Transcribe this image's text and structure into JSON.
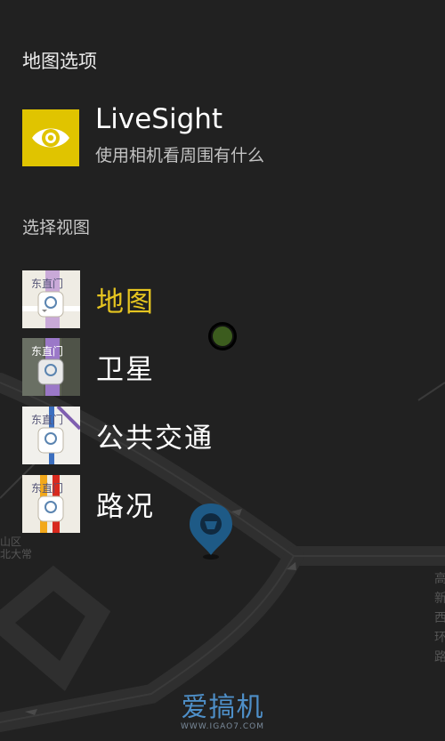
{
  "header": {
    "title": "地图选项"
  },
  "livesight": {
    "title": "LiveSight",
    "description": "使用相机看周围有什么",
    "icon": "eye-icon",
    "tile_color": "#e0c400"
  },
  "views": {
    "section_title": "选择视图",
    "items": [
      {
        "label": "地图",
        "thumb_text": "东直门",
        "active": true
      },
      {
        "label": "卫星",
        "thumb_text": "东直门",
        "active": false
      },
      {
        "label": "公共交通",
        "thumb_text": "东直门",
        "active": false
      },
      {
        "label": "路况",
        "thumb_text": "东直门",
        "active": false
      }
    ]
  },
  "map": {
    "labels": [
      "山区",
      "北大常",
      "高",
      "新",
      "西",
      "环",
      "路"
    ]
  },
  "watermark": {
    "main": "爱搞机",
    "sub": "WWW.IGAO7.COM"
  },
  "colors": {
    "accent": "#e6c520",
    "background": "#212121",
    "pin": "#1e5a86"
  }
}
